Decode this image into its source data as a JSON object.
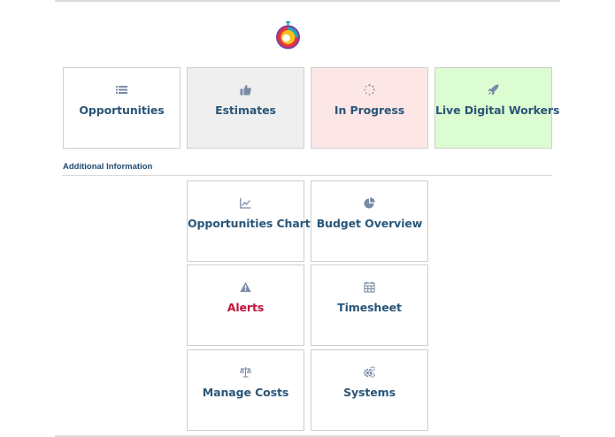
{
  "colors": {
    "label": "#2a5678",
    "alert_label": "#c0123a",
    "icon": "#7a8ba6",
    "estimates_bg": "#efefef",
    "in_progress_bg": "#fde6e6",
    "live_bg": "#dcfcd2"
  },
  "logo": {
    "icon": "stopwatch-logo-icon"
  },
  "main_tiles": [
    {
      "label": "Opportunities",
      "icon": "list-icon"
    },
    {
      "label": "Estimates",
      "icon": "thumbs-up-icon"
    },
    {
      "label": "In Progress",
      "icon": "spinner-icon"
    },
    {
      "label": "Live Digital Workers",
      "icon": "rocket-icon"
    }
  ],
  "additional": {
    "title": "Additional Information",
    "tiles": [
      {
        "label": "Opportunities Chart",
        "icon": "line-chart-icon"
      },
      {
        "label": "Budget Overview",
        "icon": "pie-chart-icon"
      },
      {
        "label": "Alerts",
        "icon": "warning-icon"
      },
      {
        "label": "Timesheet",
        "icon": "calendar-icon"
      },
      {
        "label": "Manage Costs",
        "icon": "balance-scale-icon"
      },
      {
        "label": "Systems",
        "icon": "cogs-icon"
      }
    ]
  }
}
